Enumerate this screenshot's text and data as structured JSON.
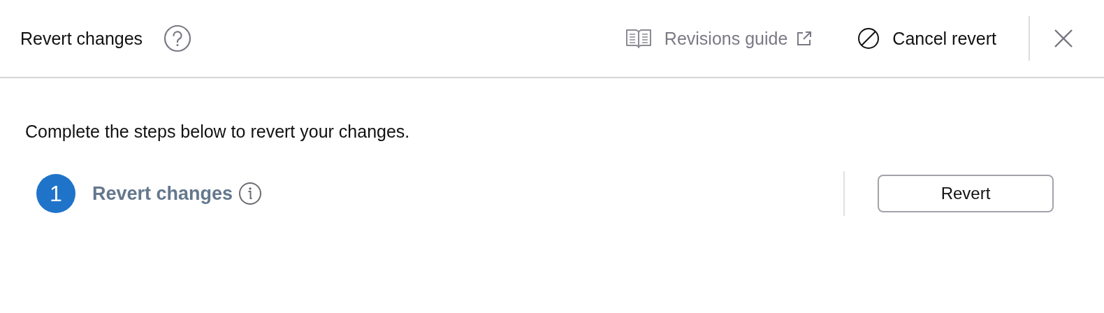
{
  "header": {
    "title": "Revert changes",
    "guide_link": "Revisions guide",
    "cancel_button": "Cancel revert"
  },
  "body": {
    "instructions": "Complete the steps below to revert your changes.",
    "steps": [
      {
        "number": "1",
        "label": "Revert changes",
        "active": true,
        "action": "Revert"
      }
    ]
  }
}
